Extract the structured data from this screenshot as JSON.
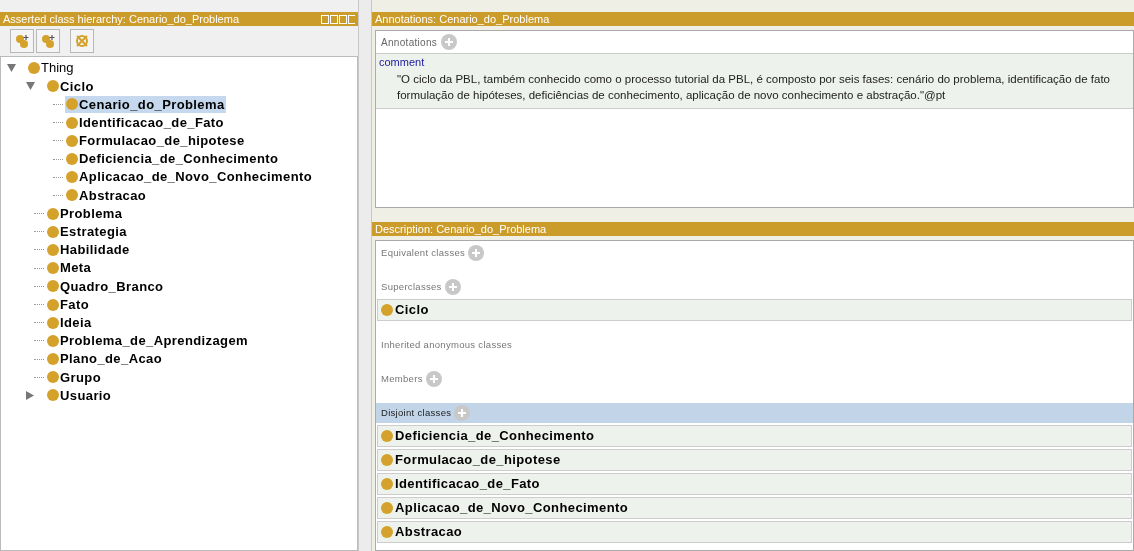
{
  "hierarchy": {
    "title": "Asserted class hierarchy: Cenario_do_Problema",
    "tree": [
      {
        "label": "Thing",
        "kind": "root",
        "expanded": true,
        "selected": false,
        "children": [
          {
            "label": "Ciclo",
            "kind": "branch",
            "expanded": true,
            "selected": false,
            "children": [
              {
                "label": "Cenario_do_Problema",
                "kind": "leaf",
                "selected": true
              },
              {
                "label": "Identificacao_de_Fato",
                "kind": "leaf",
                "selected": false
              },
              {
                "label": "Formulacao_de_hipotese",
                "kind": "leaf",
                "selected": false
              },
              {
                "label": "Deficiencia_de_Conhecimento",
                "kind": "leaf",
                "selected": false
              },
              {
                "label": "Aplicacao_de_Novo_Conhecimento",
                "kind": "leaf",
                "selected": false
              },
              {
                "label": "Abstracao",
                "kind": "leaf",
                "selected": false
              }
            ]
          },
          {
            "label": "Problema",
            "kind": "leaf",
            "selected": false
          },
          {
            "label": "Estrategia",
            "kind": "leaf",
            "selected": false
          },
          {
            "label": "Habilidade",
            "kind": "leaf",
            "selected": false
          },
          {
            "label": "Meta",
            "kind": "leaf",
            "selected": false
          },
          {
            "label": "Quadro_Branco",
            "kind": "leaf",
            "selected": false
          },
          {
            "label": "Fato",
            "kind": "leaf",
            "selected": false
          },
          {
            "label": "Ideia",
            "kind": "leaf",
            "selected": false
          },
          {
            "label": "Problema_de_Aprendizagem",
            "kind": "leaf",
            "selected": false
          },
          {
            "label": "Plano_de_Acao",
            "kind": "leaf",
            "selected": false
          },
          {
            "label": "Grupo",
            "kind": "leaf",
            "selected": false
          },
          {
            "label": "Usuario",
            "kind": "branch",
            "expanded": false,
            "selected": false
          }
        ]
      }
    ]
  },
  "annotations": {
    "title": "Annotations: Cenario_do_Problema",
    "section": "Annotations",
    "items": [
      {
        "property": "comment",
        "value": "\"O ciclo da PBL, também conhecido como o processo tutorial da PBL, é composto por seis fases: cenário do problema, identificação de fato formulação de hipóteses, deficiências de conhecimento, aplicação de novo conhecimento e abstração.\"@pt"
      }
    ]
  },
  "description": {
    "title": "Description: Cenario_do_Problema",
    "sections": [
      {
        "label": "Equivalent classes",
        "addable": true,
        "highlighted": false
      },
      {
        "label": "Superclasses",
        "addable": true,
        "highlighted": false,
        "items": [
          "Ciclo"
        ]
      },
      {
        "label": "Inherited anonymous classes",
        "addable": false,
        "highlighted": false
      },
      {
        "label": "Members",
        "addable": true,
        "highlighted": false
      },
      {
        "label": "Disjoint classes",
        "addable": true,
        "highlighted": true,
        "items": [
          "Deficiencia_de_Conhecimento",
          "Formulacao_de_hipotese",
          "Identificacao_de_Fato",
          "Aplicacao_de_Novo_Conhecimento",
          "Abstracao"
        ]
      }
    ]
  }
}
